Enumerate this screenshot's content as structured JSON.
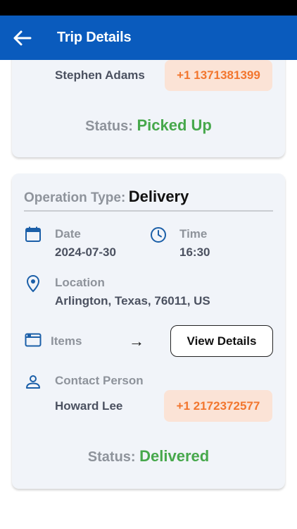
{
  "appbar": {
    "title": "Trip Details",
    "back_icon": "arrow-left-icon",
    "color": "#0a5bbd"
  },
  "card1": {
    "contact_name": "Stephen Adams",
    "phone": "+1 1371381399",
    "status_label": "Status:",
    "status_value": "Picked Up"
  },
  "card2": {
    "operation_label": "Operation Type:",
    "operation_value": "Delivery",
    "date_label": "Date",
    "date_value": "2024-07-30",
    "time_label": "Time",
    "time_value": "16:30",
    "location_label": "Location",
    "location_value": "Arlington, Texas, 76011, US",
    "items_label": "Items",
    "items_arrow": "→",
    "view_details_label": "View Details",
    "contact_label": "Contact Person",
    "contact_name": "Howard Lee",
    "phone": "+1 2172372577",
    "status_label": "Status:",
    "status_value": "Delivered"
  },
  "colors": {
    "status_green": "#47a84c",
    "phone_text": "#f2762e",
    "phone_bg": "#fbe3d6",
    "icon_blue": "#1b5fa8"
  }
}
